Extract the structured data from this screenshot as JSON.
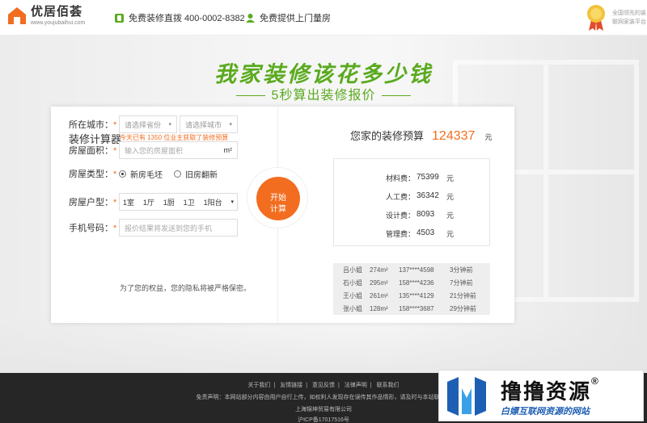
{
  "header": {
    "logo_name": "优居佰荟",
    "logo_url": "www.youjubaihui.com",
    "hotline": "免费装修直拨 400-0002-8382",
    "service": "免费提供上门量房",
    "award_line1": "全国领先的装",
    "award_line2": "联网家装平台"
  },
  "hero": {
    "title": "我家装修该花多少钱",
    "subtitle": "5秒算出装修报价"
  },
  "calculator": {
    "title": "装修计算器",
    "note_prefix": "今天已有",
    "note_count": "1350",
    "note_suffix": "位业主获取了装修预算",
    "city_label": "所在城市：",
    "province_placeholder": "请选择省份",
    "city_placeholder": "请选择城市",
    "area_label": "房屋面积：",
    "area_placeholder": "输入您的房屋面积",
    "area_unit": "m²",
    "type_label": "房屋类型：",
    "type_new": "新房毛坯",
    "type_old": "旧房翻新",
    "layout_label": "房屋户型：",
    "layout": [
      "1室",
      "1厅",
      "1厨",
      "1卫",
      "1阳台"
    ],
    "phone_label": "手机号码：",
    "phone_placeholder": "报价结果将发送到您的手机",
    "privacy": "为了您的权益，您的隐私将被严格保密。",
    "button_line1": "开始",
    "button_line2": "计算",
    "required_mark": "*"
  },
  "budget": {
    "title": "您家的装修预算",
    "value": "124337",
    "unit": "元",
    "items": [
      {
        "label": "材料费：",
        "value": "75399",
        "unit": "元"
      },
      {
        "label": "人工费：",
        "value": "36342",
        "unit": "元"
      },
      {
        "label": "设计费：",
        "value": "8093",
        "unit": "元"
      },
      {
        "label": "管理费：",
        "value": "4503",
        "unit": "元"
      }
    ],
    "recent": [
      {
        "name": "吕小姐",
        "area": "274m²",
        "phone": "137****4598",
        "time": "3分钟前"
      },
      {
        "name": "石小姐",
        "area": "295m²",
        "phone": "158****4236",
        "time": "7分钟前"
      },
      {
        "name": "王小姐",
        "area": "261m²",
        "phone": "135****4129",
        "time": "21分钟前"
      },
      {
        "name": "张小姐",
        "area": "128m²",
        "phone": "158****3687",
        "time": "29分钟前"
      }
    ]
  },
  "footer": {
    "links": [
      "关于我们",
      "友情链接",
      "意见反馈",
      "法律声明",
      "联系我们"
    ],
    "separator": "|",
    "disclaimer": "免责声明：本网站部分内容由用户自行上传，如权利人发现存在误传其作品情形，请及时与本站联系。",
    "company": "上海锦坤贸易有限公司",
    "icp": "沪ICP备17017516号"
  },
  "watermark": {
    "title": "撸撸资源",
    "reg": "®",
    "subtitle": "白嫖互联网资源的网站"
  },
  "colors": {
    "accent": "#f26d1f",
    "green": "#5aaa1e",
    "footer_bg": "#262626"
  }
}
